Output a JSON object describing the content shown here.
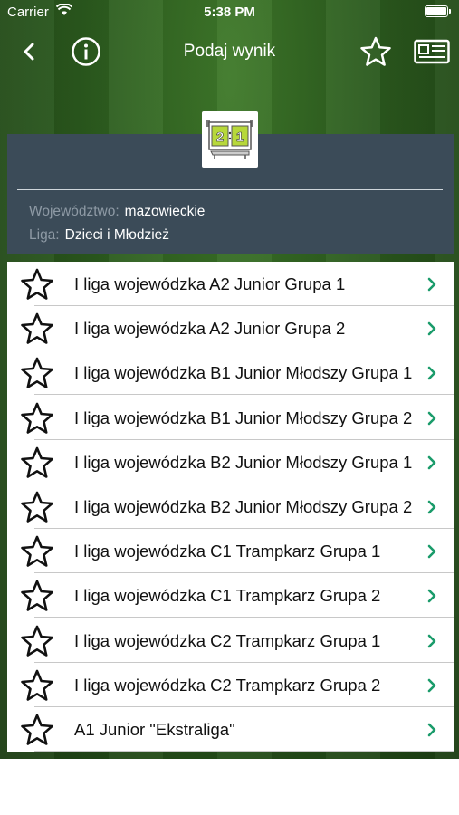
{
  "status_bar": {
    "carrier": "Carrier",
    "time": "5:38 PM"
  },
  "nav": {
    "title": "Podaj wynik"
  },
  "header": {
    "scoreboard": {
      "left": "2",
      "right": "1"
    },
    "wojewodztwo_label": "Województwo:",
    "wojewodztwo_value": "mazowieckie",
    "liga_label": "Liga:",
    "liga_value": "Dzieci i Młodzież"
  },
  "colors": {
    "accent": "#1a9b6a",
    "header_bg": "#3b4b58",
    "scoreboard_green": "#b7d83a"
  },
  "items": [
    {
      "label": "I liga wojewódzka A2 Junior Grupa 1"
    },
    {
      "label": "I liga wojewódzka A2 Junior Grupa 2"
    },
    {
      "label": "I liga wojewódzka B1 Junior Młodszy Grupa 1"
    },
    {
      "label": "I liga wojewódzka B1 Junior Młodszy Grupa 2"
    },
    {
      "label": "I liga wojewódzka B2 Junior Młodszy Grupa 1"
    },
    {
      "label": "I liga wojewódzka B2 Junior Młodszy Grupa 2"
    },
    {
      "label": "I liga wojewódzka C1 Trampkarz Grupa 1"
    },
    {
      "label": "I liga wojewódzka C1 Trampkarz Grupa 2"
    },
    {
      "label": "I liga wojewódzka C2 Trampkarz Grupa 1"
    },
    {
      "label": "I liga wojewódzka C2 Trampkarz Grupa 2"
    },
    {
      "label": "A1 Junior \"Ekstraliga\""
    }
  ]
}
